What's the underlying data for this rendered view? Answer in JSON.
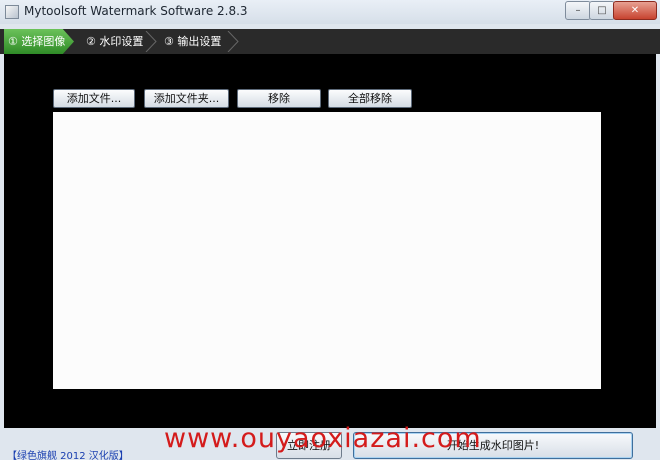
{
  "window": {
    "title": "Mytoolsoft Watermark Software 2.8.3",
    "controls": {
      "minimize": "–",
      "maximize": "□",
      "close": "✕"
    }
  },
  "steps": [
    {
      "label": "① 选择图像",
      "active": true
    },
    {
      "label": "② 水印设置",
      "active": false
    },
    {
      "label": "③ 输出设置",
      "active": false
    }
  ],
  "toolbar": {
    "add_files": "添加文件...",
    "add_folder": "添加文件夹...",
    "remove": "移除",
    "remove_all": "全部移除"
  },
  "footer": {
    "brand": "【绿色旗舰 2012 汉化版】",
    "register": "立即注册",
    "start": "开始生成水印图片!"
  },
  "overlay": {
    "watermark": "www.ouyaoxiazai.com"
  },
  "colors": {
    "active_step": "#4aa63a",
    "step_bar": "#2a2a2a",
    "workspace": "#000000",
    "watermark": "#d41b1b",
    "brand_text": "#1a3fb0"
  }
}
